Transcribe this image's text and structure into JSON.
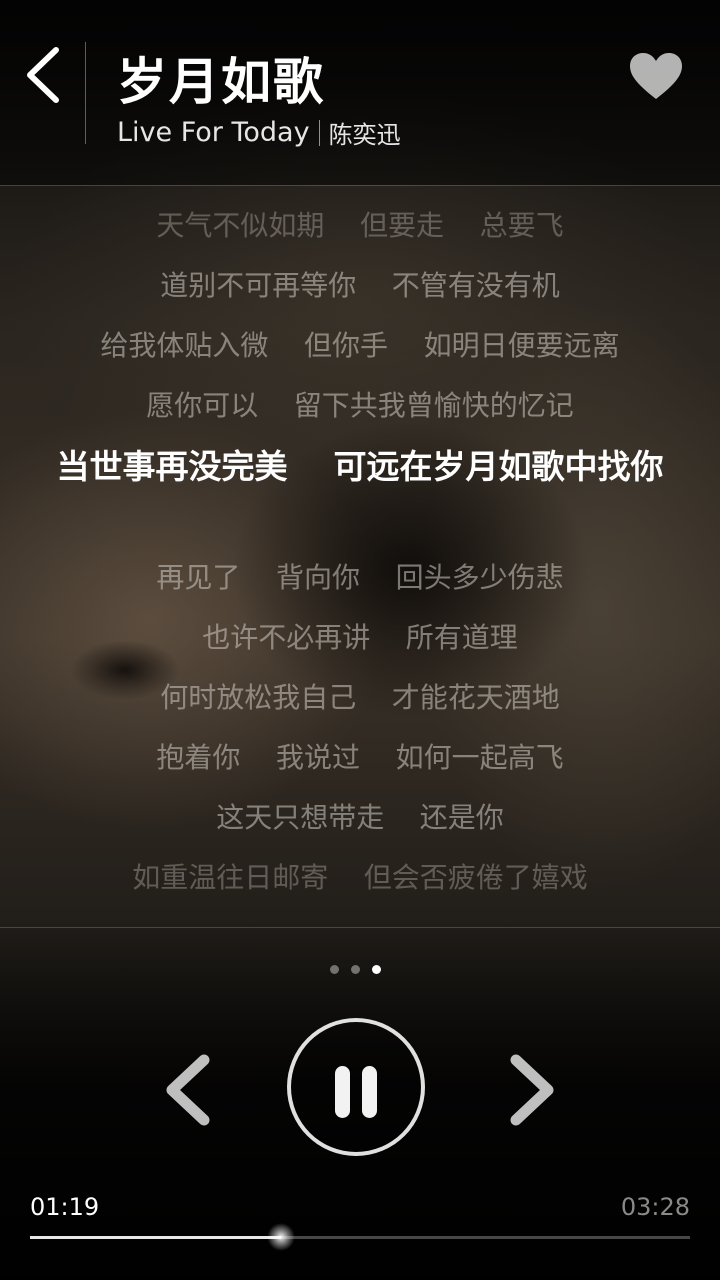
{
  "header": {
    "title": "岁月如歌",
    "album": "Live For Today",
    "artist": "陈奕迅"
  },
  "lyrics": {
    "lines": [
      {
        "text": "天气不似如期    但要走    总要飞",
        "state": "dim"
      },
      {
        "text": "道别不可再等你    不管有没有机",
        "state": "normal"
      },
      {
        "text": "给我体贴入微    但你手    如明日便要远离",
        "state": "normal"
      },
      {
        "text": "愿你可以    留下共我曾愉快的忆记",
        "state": "normal"
      },
      {
        "text": "当世事再没完美    可远在岁月如歌中找你",
        "state": "active"
      },
      {
        "text": "再见了    背向你    回头多少伤悲",
        "state": "normal"
      },
      {
        "text": "也许不必再讲    所有道理",
        "state": "normal"
      },
      {
        "text": "何时放松我自己    才能花天酒地",
        "state": "normal"
      },
      {
        "text": "抱着你    我说过    如何一起高飞",
        "state": "normal"
      },
      {
        "text": "这天只想带走    还是你",
        "state": "normal"
      },
      {
        "text": "如重温往日邮寄    但会否疲倦了嬉戏",
        "state": "dim"
      }
    ]
  },
  "pager": {
    "pages": 3,
    "current": 3
  },
  "player": {
    "state": "playing",
    "current_time": "01:19",
    "total_time": "03:28",
    "progress": 0.38
  },
  "icons": {
    "back": "chevron-left-icon",
    "favorite": "heart-icon",
    "previous": "chevron-left-icon",
    "next": "chevron-right-icon",
    "pause": "pause-icon"
  },
  "colors": {
    "accent": "#ffffff",
    "muted_text": "#8a8a8a"
  }
}
